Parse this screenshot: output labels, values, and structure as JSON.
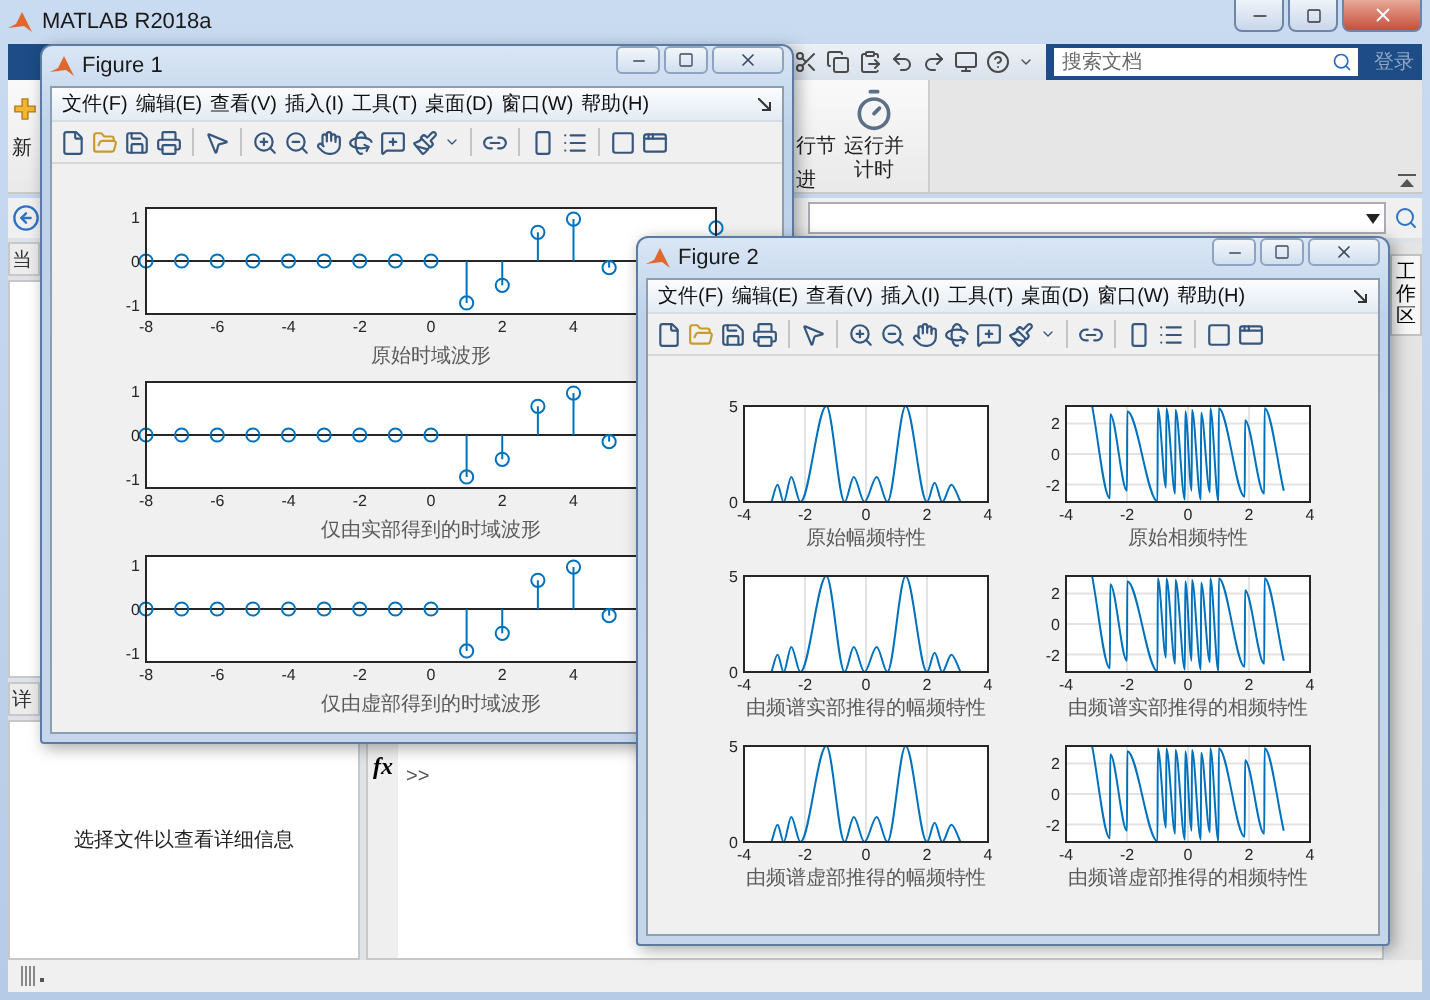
{
  "main_window": {
    "title": "MATLAB R2018a",
    "search": {
      "placeholder": "搜索文档"
    },
    "sign_in": "登录",
    "ribbon": {
      "new_label": "新",
      "run_labels": [
        "行节",
        "进"
      ],
      "run_and_time_button": "运行并计时"
    },
    "current_folder_header": "当",
    "details_header": "详",
    "details_message": "选择文件以查看详细信息",
    "function_button": "fx",
    "command_prompt": ">>",
    "workspace_tab": "工作区"
  },
  "figures": [
    {
      "title": "Figure 1",
      "menu": [
        "文件(F)",
        "编辑(E)",
        "查看(V)",
        "插入(I)",
        "工具(T)",
        "桌面(D)",
        "窗口(W)",
        "帮助(H)"
      ],
      "charts": [
        {
          "chart_data": {
            "type": "scatter",
            "xlabel": "原始时域波形",
            "x": [
              -8,
              -7,
              -6,
              -5,
              -4,
              -3,
              -2,
              -1,
              0,
              1,
              2,
              3,
              4,
              5,
              6,
              7,
              8
            ],
            "values": [
              0,
              0,
              0,
              0,
              0,
              0,
              0,
              0,
              0,
              -0.95,
              -0.55,
              0.65,
              0.95,
              -0.15,
              null,
              null,
              0.75
            ],
            "xlim": [
              -8,
              8
            ],
            "ylim": [
              -1.2,
              1.2
            ],
            "xticks": [
              -8,
              -6,
              -4,
              -2,
              0,
              2,
              4
            ],
            "yticks": [
              -1,
              0,
              1
            ]
          }
        },
        {
          "chart_data": {
            "type": "scatter",
            "xlabel": "仅由实部得到的时域波形",
            "x": [
              -8,
              -7,
              -6,
              -5,
              -4,
              -3,
              -2,
              -1,
              0,
              1,
              2,
              3,
              4,
              5
            ],
            "values": [
              0,
              0,
              0,
              0,
              0,
              0,
              0,
              0,
              0,
              -0.95,
              -0.55,
              0.65,
              0.95,
              -0.15
            ],
            "xlim": [
              -8,
              8
            ],
            "ylim": [
              -1.2,
              1.2
            ],
            "xticks": [
              -8,
              -6,
              -4,
              -2,
              0,
              2,
              4
            ],
            "yticks": [
              -1,
              0,
              1
            ]
          }
        },
        {
          "chart_data": {
            "type": "scatter",
            "xlabel": "仅由虚部得到的时域波形",
            "x": [
              -8,
              -7,
              -6,
              -5,
              -4,
              -3,
              -2,
              -1,
              0,
              1,
              2,
              3,
              4,
              5
            ],
            "values": [
              0,
              0,
              0,
              0,
              0,
              0,
              0,
              0,
              0,
              -0.95,
              -0.55,
              0.65,
              0.95,
              -0.15
            ],
            "xlim": [
              -8,
              8
            ],
            "ylim": [
              -1.2,
              1.2
            ],
            "xticks": [
              -8,
              -6,
              -4,
              -2,
              0,
              2,
              4
            ],
            "yticks": [
              -1,
              0,
              1
            ]
          }
        }
      ]
    },
    {
      "title": "Figure 2",
      "menu": [
        "文件(F)",
        "编辑(E)",
        "查看(V)",
        "插入(I)",
        "工具(T)",
        "桌面(D)",
        "窗口(W)",
        "帮助(H)"
      ],
      "charts": [
        {
          "chart_data": {
            "type": "line",
            "xlabel": "原始幅频特性",
            "x": [
              -3.1,
              -2.9,
              -2.7,
              -2.45,
              -2.15,
              -1.3,
              -0.7,
              -0.4,
              -0.05,
              0.35,
              0.7,
              1.3,
              2.0,
              2.25,
              2.5,
              2.8,
              3.1
            ],
            "values": [
              0,
              0.9,
              0,
              1.3,
              0,
              5,
              0,
              1.3,
              0,
              1.3,
              0,
              5,
              0,
              1.0,
              0,
              0.9,
              0
            ],
            "xlim": [
              -4,
              4
            ],
            "ylim": [
              0,
              5
            ],
            "xticks": [
              -4,
              -2,
              0,
              2,
              4
            ],
            "yticks": [
              0,
              5
            ],
            "grid": true
          }
        },
        {
          "chart_data": {
            "type": "line",
            "xlabel": "原始相频特性",
            "x": [
              -3.14,
              -2.56,
              -2.55,
              -2.0,
              -1.99,
              -1.0,
              -0.99,
              -0.72,
              -0.71,
              -0.42,
              -0.41,
              -0.1,
              -0.09,
              0.12,
              0.13,
              0.42,
              0.43,
              0.72,
              0.73,
              1.0,
              1.01,
              1.86,
              1.87,
              2.5,
              2.51,
              3.14
            ],
            "values": [
              3.1,
              -2.9,
              2.6,
              -2.4,
              2.8,
              -3.1,
              3.0,
              -2.2,
              3.0,
              -2.6,
              2.9,
              -3.0,
              2.8,
              -2.4,
              2.9,
              -3.0,
              2.7,
              -2.5,
              3.0,
              -3.1,
              3.0,
              -2.8,
              2.2,
              -2.6,
              3.0,
              -2.4
            ],
            "xlim": [
              -4,
              4
            ],
            "ylim": [
              -3.14,
              3.14
            ],
            "xticks": [
              -4,
              -2,
              0,
              2,
              4
            ],
            "yticks": [
              -2,
              0,
              2
            ],
            "grid": true
          }
        },
        {
          "chart_data": {
            "type": "line",
            "xlabel": "由频谱实部推得的幅频特性",
            "x": [
              -3.1,
              -2.9,
              -2.7,
              -2.45,
              -2.15,
              -1.3,
              -0.7,
              -0.4,
              -0.05,
              0.35,
              0.7,
              1.3,
              2.0,
              2.25,
              2.5,
              2.8,
              3.1
            ],
            "values": [
              0,
              0.9,
              0,
              1.3,
              0,
              5,
              0,
              1.3,
              0,
              1.3,
              0,
              5,
              0,
              1.0,
              0,
              0.9,
              0
            ],
            "xlim": [
              -4,
              4
            ],
            "ylim": [
              0,
              5
            ],
            "xticks": [
              -4,
              -2,
              0,
              2,
              4
            ],
            "yticks": [
              0,
              5
            ],
            "grid": true
          }
        },
        {
          "chart_data": {
            "type": "line",
            "xlabel": "由频谱实部推得的相频特性",
            "x": [
              -3.14,
              -2.56,
              -2.55,
              -2.0,
              -1.99,
              -1.0,
              -0.99,
              -0.72,
              -0.71,
              -0.42,
              -0.41,
              -0.1,
              -0.09,
              0.12,
              0.13,
              0.42,
              0.43,
              0.72,
              0.73,
              1.0,
              1.01,
              1.86,
              1.87,
              2.5,
              2.51,
              3.14
            ],
            "values": [
              3.1,
              -2.9,
              2.6,
              -2.4,
              2.8,
              -3.1,
              3.0,
              -2.2,
              3.0,
              -2.6,
              2.9,
              -3.0,
              2.8,
              -2.4,
              2.9,
              -3.0,
              2.7,
              -2.5,
              3.0,
              -3.1,
              3.0,
              -2.8,
              2.2,
              -2.6,
              3.0,
              -2.4
            ],
            "xlim": [
              -4,
              4
            ],
            "ylim": [
              -3.14,
              3.14
            ],
            "xticks": [
              -4,
              -2,
              0,
              2,
              4
            ],
            "yticks": [
              -2,
              0,
              2
            ],
            "grid": true
          }
        },
        {
          "chart_data": {
            "type": "line",
            "xlabel": "由频谱虚部推得的幅频特性",
            "x": [
              -3.1,
              -2.9,
              -2.7,
              -2.45,
              -2.15,
              -1.3,
              -0.7,
              -0.4,
              -0.05,
              0.35,
              0.7,
              1.3,
              2.0,
              2.25,
              2.5,
              2.8,
              3.1
            ],
            "values": [
              0,
              0.9,
              0,
              1.3,
              0,
              5,
              0,
              1.3,
              0,
              1.3,
              0,
              5,
              0,
              1.0,
              0,
              0.9,
              0
            ],
            "xlim": [
              -4,
              4
            ],
            "ylim": [
              0,
              5
            ],
            "xticks": [
              -4,
              -2,
              0,
              2,
              4
            ],
            "yticks": [
              0,
              5
            ],
            "grid": true
          }
        },
        {
          "chart_data": {
            "type": "line",
            "xlabel": "由频谱虚部推得的相频特性",
            "x": [
              -3.14,
              -2.56,
              -2.55,
              -2.0,
              -1.99,
              -1.0,
              -0.99,
              -0.72,
              -0.71,
              -0.42,
              -0.41,
              -0.1,
              -0.09,
              0.12,
              0.13,
              0.42,
              0.43,
              0.72,
              0.73,
              1.0,
              1.01,
              1.86,
              1.87,
              2.5,
              2.51,
              3.14
            ],
            "values": [
              3.1,
              -2.9,
              2.6,
              -2.4,
              2.8,
              -3.1,
              3.0,
              -2.2,
              3.0,
              -2.6,
              2.9,
              -3.0,
              2.8,
              -2.4,
              2.9,
              -3.0,
              2.7,
              -2.5,
              3.0,
              -3.1,
              3.0,
              -2.8,
              2.2,
              -2.6,
              3.0,
              -2.4
            ],
            "xlim": [
              -4,
              4
            ],
            "ylim": [
              -3.14,
              3.14
            ],
            "xticks": [
              -4,
              -2,
              0,
              2,
              4
            ],
            "yticks": [
              -2,
              0,
              2
            ],
            "grid": true
          }
        }
      ]
    }
  ]
}
